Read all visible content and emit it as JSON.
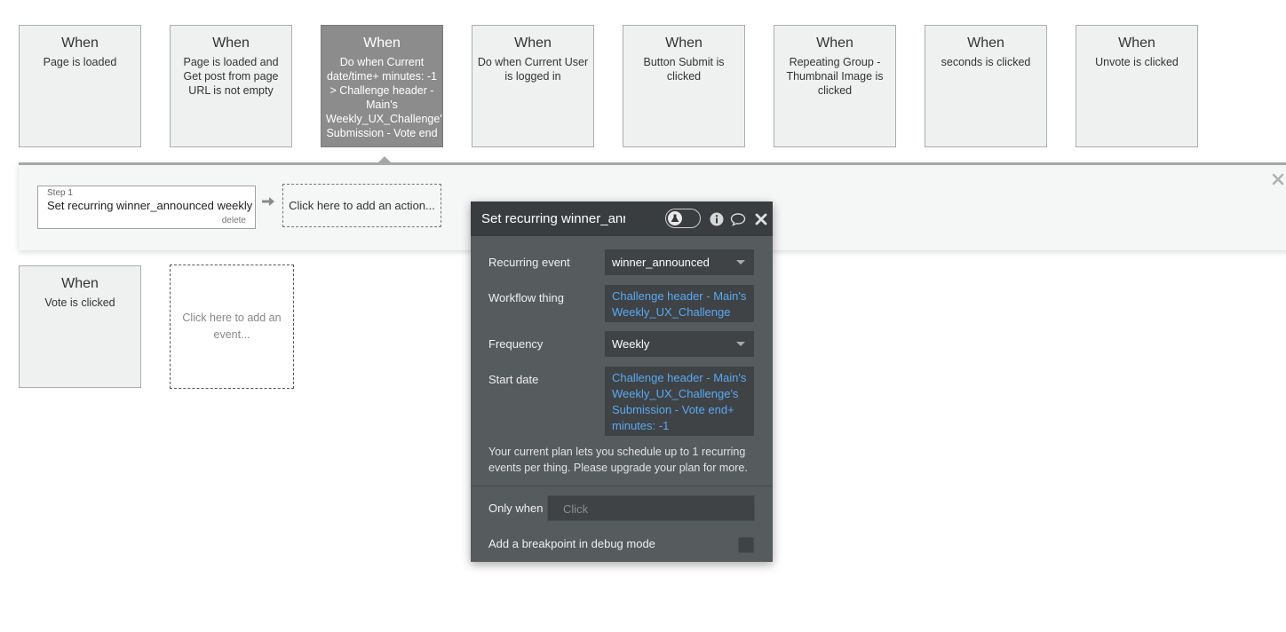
{
  "events_row1": [
    {
      "when": "When",
      "desc": "Page is loaded"
    },
    {
      "when": "When",
      "desc": "Page is loaded and Get post from page URL is not empty"
    },
    {
      "when": "When",
      "desc": "Do when Current date/time+ minutes: -1 > Challenge header - Main's Weekly_UX_Challenge's Submission - Vote end",
      "selected": true
    },
    {
      "when": "When",
      "desc": "Do when Current User is logged in"
    },
    {
      "when": "When",
      "desc": "Button Submit is clicked"
    },
    {
      "when": "When",
      "desc": "Repeating Group - Thumbnail Image is clicked"
    },
    {
      "when": "When",
      "desc": "seconds is clicked"
    },
    {
      "when": "When",
      "desc": "Unvote is clicked"
    }
  ],
  "events_row2": [
    {
      "when": "When",
      "desc": "Vote is clicked"
    }
  ],
  "add_event_label": "Click here to add an event...",
  "actions": {
    "step_label": "Step 1",
    "step_name": "Set recurring winner_announced weekly",
    "delete_label": "delete",
    "add_action_label": "Click here to add an action..."
  },
  "panel": {
    "title": "Set recurring winner_announced weekly",
    "recurring_event_label": "Recurring event",
    "recurring_event_value": "winner_announced",
    "workflow_thing_label": "Workflow thing",
    "workflow_thing_value": "Challenge header - Main's Weekly_UX_Challenge",
    "frequency_label": "Frequency",
    "frequency_value": "Weekly",
    "start_date_label": "Start date",
    "start_date_value": "Challenge header - Main's Weekly_UX_Challenge's Submission - Vote end+ minutes: -1",
    "plan_note": "Your current plan lets you schedule up to 1 recurring events per thing. Please upgrade your plan for more.",
    "only_when_label": "Only when",
    "only_when_placeholder": "Click",
    "breakpoint_label": "Add a breakpoint in debug mode"
  },
  "colors": {
    "card_bg": "#eff1f0",
    "card_selected_bg": "#8c8c8c",
    "panel_bg": "#565b5e",
    "panel_header_bg": "#393d40",
    "link_blue": "#5aa8f0"
  },
  "icons": [
    "arrow-right-icon",
    "close-icon",
    "flask-icon",
    "info-icon",
    "comment-icon"
  ]
}
